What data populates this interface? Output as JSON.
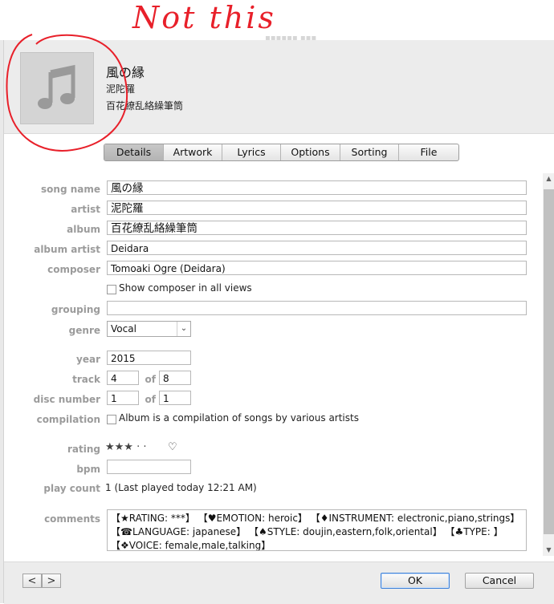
{
  "annotation": {
    "text": "Not this"
  },
  "header": {
    "title": "風の縁",
    "artist": "泥陀羅",
    "album": "百花繚乱絡繰筆筒"
  },
  "tabs": [
    {
      "label": "Details",
      "active": true
    },
    {
      "label": "Artwork",
      "active": false
    },
    {
      "label": "Lyrics",
      "active": false
    },
    {
      "label": "Options",
      "active": false
    },
    {
      "label": "Sorting",
      "active": false
    },
    {
      "label": "File",
      "active": false
    }
  ],
  "labels": {
    "song_name": "song name",
    "artist": "artist",
    "album": "album",
    "album_artist": "album artist",
    "composer": "composer",
    "grouping": "grouping",
    "genre": "genre",
    "year": "year",
    "track": "track",
    "disc_number": "disc number",
    "compilation": "compilation",
    "rating": "rating",
    "bpm": "bpm",
    "play_count": "play count",
    "comments": "comments",
    "of": "of"
  },
  "fields": {
    "song_name": "風の縁",
    "artist": "泥陀羅",
    "album": "百花繚乱絡繰筆筒",
    "album_artist": "Deidara",
    "composer": "Tomoaki Ogre (Deidara)",
    "grouping": "",
    "genre": "Vocal",
    "year": "2015",
    "track": "4",
    "track_of": "8",
    "disc": "1",
    "disc_of": "1",
    "bpm": "",
    "play_count": "1 (Last played today 12:21 AM)",
    "comments": "【★RATING: ***】 【♥EMOTION: heroic】 【♦INSTRUMENT: electronic,piano,strings】 【☎LANGUAGE: japanese】 【♠STYLE: doujin,eastern,folk,oriental】 【♣TYPE: 】 【❖VOICE: female,male,talking】"
  },
  "checkboxes": {
    "show_composer": {
      "label": "Show composer in all views",
      "checked": false
    },
    "compilation": {
      "label": "Album is a compilation of songs by various artists",
      "checked": false
    }
  },
  "rating": {
    "stars_filled": 3,
    "stars_total": 5,
    "display": "★★★ · ·",
    "heart": "♡"
  },
  "footer": {
    "prev": "<",
    "next": ">",
    "ok": "OK",
    "cancel": "Cancel"
  },
  "colors": {
    "annotation": "#e8202a",
    "label": "#9b9b9b",
    "ok_border": "#3d80d8"
  }
}
